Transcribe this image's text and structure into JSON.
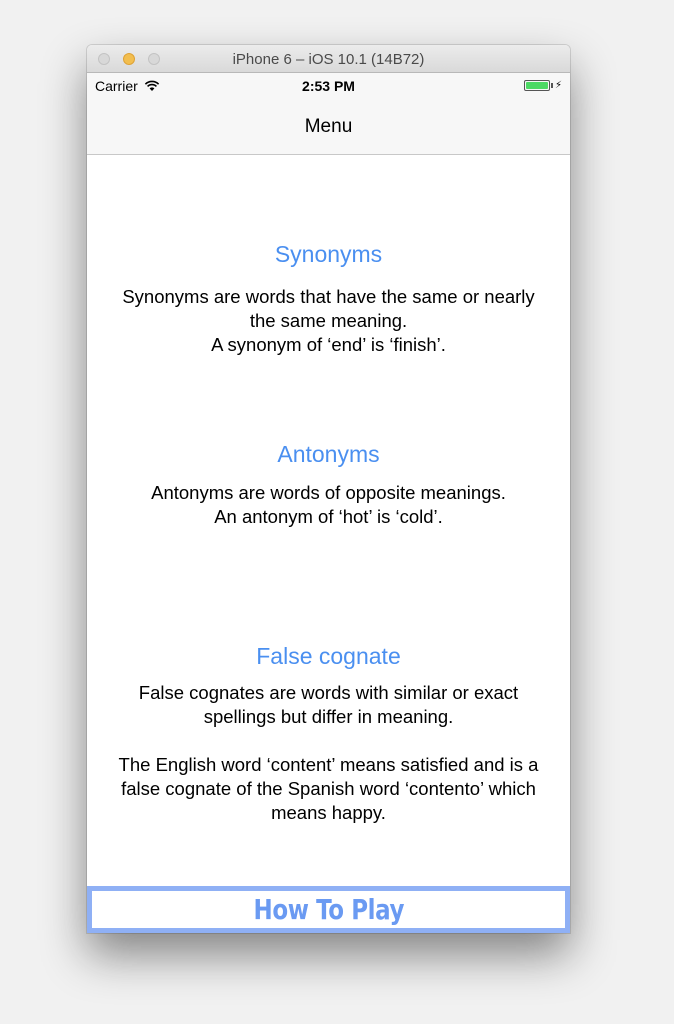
{
  "window": {
    "title": "iPhone 6 – iOS 10.1 (14B72)"
  },
  "status_bar": {
    "carrier": "Carrier",
    "time": "2:53 PM",
    "battery_level": 1.0
  },
  "nav": {
    "title": "Menu"
  },
  "sections": [
    {
      "title": "Synonyms",
      "lines": [
        "Synonyms are words that have the same or nearly",
        "the same meaning.",
        "A synonym of ‘end’ is ‘finish’."
      ]
    },
    {
      "title": "Antonyms",
      "lines": [
        "Antonyms are words of opposite meanings.",
        "An antonym of ‘hot’ is ‘cold’."
      ]
    },
    {
      "title": "False cognate",
      "lines": [
        "False cognates are words with similar or exact",
        "spellings but differ in meaning."
      ],
      "example_lines": [
        "The English word ‘content’ means satisfied and is a",
        "false cognate of the Spanish word ‘contento’ which",
        "means happy."
      ]
    }
  ],
  "footer": {
    "button_label": "How To Play"
  },
  "colors": {
    "accent": "#4a8ff0",
    "button_border": "#8fb0f5"
  }
}
